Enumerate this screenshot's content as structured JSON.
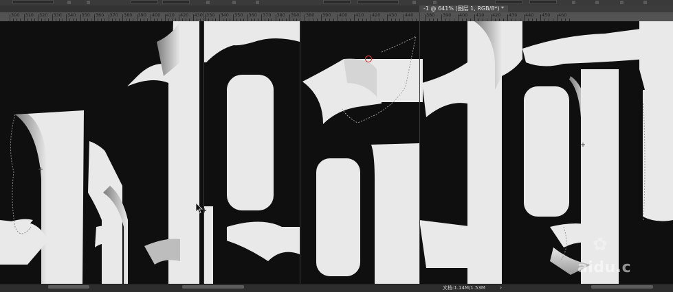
{
  "document_tab": {
    "title": "-1 @ 641% (图层 1, RGB/8*) *"
  },
  "ruler_left": {
    "labels": [
      "300",
      "310",
      "320",
      "330",
      "340",
      "350",
      "360",
      "370",
      "380",
      "390",
      "400",
      "410",
      "420",
      "430",
      "440"
    ]
  },
  "ruler_middle": {
    "labels": [
      "330",
      "340",
      "350",
      "360",
      "370",
      "380",
      "390",
      "400",
      "410"
    ]
  },
  "ruler_right_a": {
    "labels": [
      "380",
      "390",
      "400",
      "410",
      "420",
      "430",
      "440"
    ]
  },
  "ruler_right_b": {
    "labels": [
      "380",
      "390",
      "400",
      "410",
      "420",
      "430",
      "440",
      "450",
      "460"
    ]
  },
  "status_bar": {
    "doc_size": "文档:1.14M/1.53M",
    "arrow": "›"
  },
  "watermark": {
    "text": "aidu.c"
  },
  "colors": {
    "glyph": "#e9e9e9",
    "glyph_shade": "#bdbdbd",
    "background": "#0f0f0f",
    "ruler": "#535353",
    "selection_marker": "#d23a3a"
  }
}
